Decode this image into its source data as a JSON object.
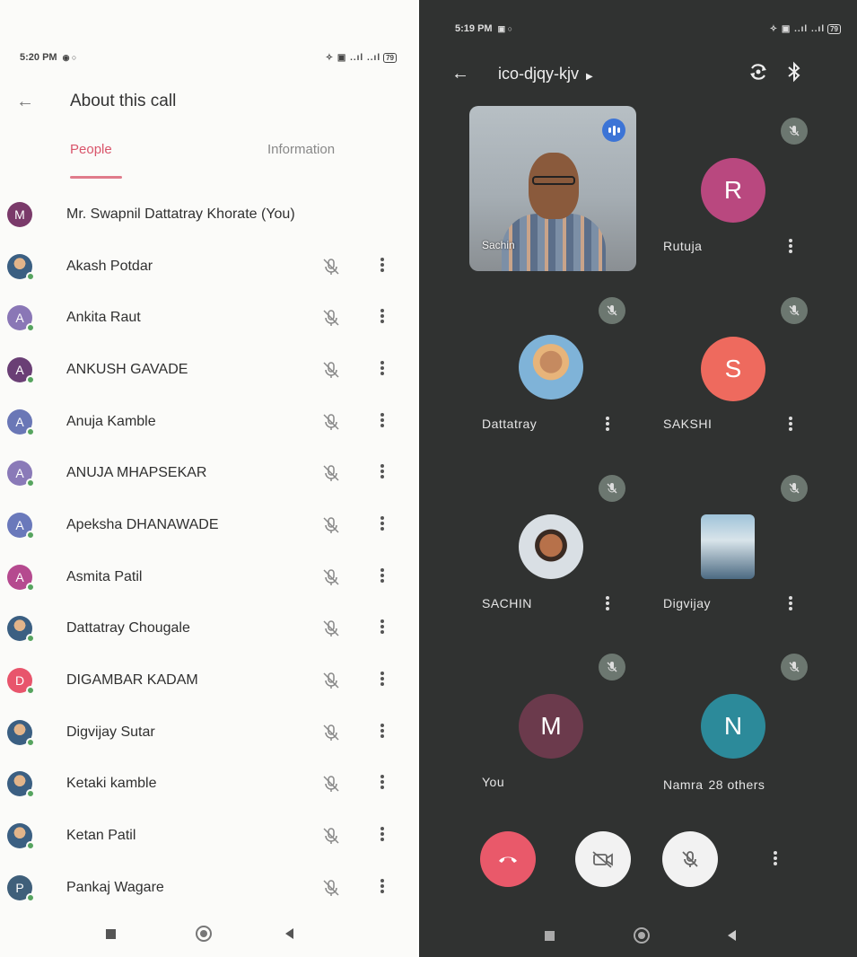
{
  "left": {
    "status": {
      "time": "5:20 PM",
      "battery": "79"
    },
    "header": {
      "title": "About this call"
    },
    "tabs": [
      {
        "label": "People",
        "active": true
      },
      {
        "label": "Information",
        "active": false
      }
    ],
    "accent_color": "#d9556b",
    "people": [
      {
        "initial": "M",
        "name": "Mr. Swapnil Dattatray Khorate (You)",
        "avatar_color": "#7a3a6a",
        "photo": false,
        "controls": false
      },
      {
        "initial": "",
        "name": "Akash Potdar",
        "avatar_color": "#3b5f82",
        "photo": true,
        "controls": true
      },
      {
        "initial": "A",
        "name": "Ankita Raut",
        "avatar_color": "#8a77b6",
        "photo": false,
        "controls": true
      },
      {
        "initial": "A",
        "name": "ANKUSH GAVADE",
        "avatar_color": "#6a3f75",
        "photo": false,
        "controls": true
      },
      {
        "initial": "A",
        "name": "Anuja Kamble",
        "avatar_color": "#6a77b6",
        "photo": false,
        "controls": true
      },
      {
        "initial": "A",
        "name": "ANUJA MHAPSEKAR",
        "avatar_color": "#8a7ab8",
        "photo": false,
        "controls": true
      },
      {
        "initial": "A",
        "name": "Apeksha DHANAWADE",
        "avatar_color": "#6a79bb",
        "photo": false,
        "controls": true
      },
      {
        "initial": "A",
        "name": "Asmita Patil",
        "avatar_color": "#b54a8f",
        "photo": false,
        "controls": true
      },
      {
        "initial": "",
        "name": "Dattatray Chougale",
        "avatar_color": "#4a7fb8",
        "photo": true,
        "controls": true
      },
      {
        "initial": "D",
        "name": "DIGAMBAR KADAM",
        "avatar_color": "#e8556c",
        "photo": false,
        "controls": true
      },
      {
        "initial": "",
        "name": "Digvijay Sutar",
        "avatar_color": "#5b6f86",
        "photo": true,
        "controls": true
      },
      {
        "initial": "",
        "name": "Ketaki kamble",
        "avatar_color": "#9a8a5a",
        "photo": true,
        "controls": true
      },
      {
        "initial": "",
        "name": "Ketan Patil",
        "avatar_color": "#6d4b3b",
        "photo": true,
        "controls": true
      },
      {
        "initial": "P",
        "name": "Pankaj Wagare",
        "avatar_color": "#3f5f7a",
        "photo": false,
        "controls": true
      }
    ]
  },
  "right": {
    "status": {
      "time": "5:19 PM",
      "battery": "79"
    },
    "meeting_code": "ico-djqy-kjv",
    "tiles": {
      "video": {
        "name": "Sachin"
      },
      "rutuja": {
        "initial": "R",
        "name": "Rutuja",
        "color": "#b9487f"
      },
      "dattatray": {
        "name": "Dattatray"
      },
      "sakshi": {
        "initial": "S",
        "name": "SAKSHI",
        "color": "#ee6a5e"
      },
      "sachin": {
        "name": "SACHIN"
      },
      "digvijay": {
        "name": "Digvijay"
      },
      "you": {
        "initial": "M",
        "name": "You",
        "color": "#6b3a4c"
      },
      "others": {
        "initial": "N",
        "name": "Namra",
        "others": "28 others",
        "color": "#2c8a9a"
      }
    },
    "colors": {
      "end_call": "#e9596a",
      "background": "#303231"
    }
  }
}
